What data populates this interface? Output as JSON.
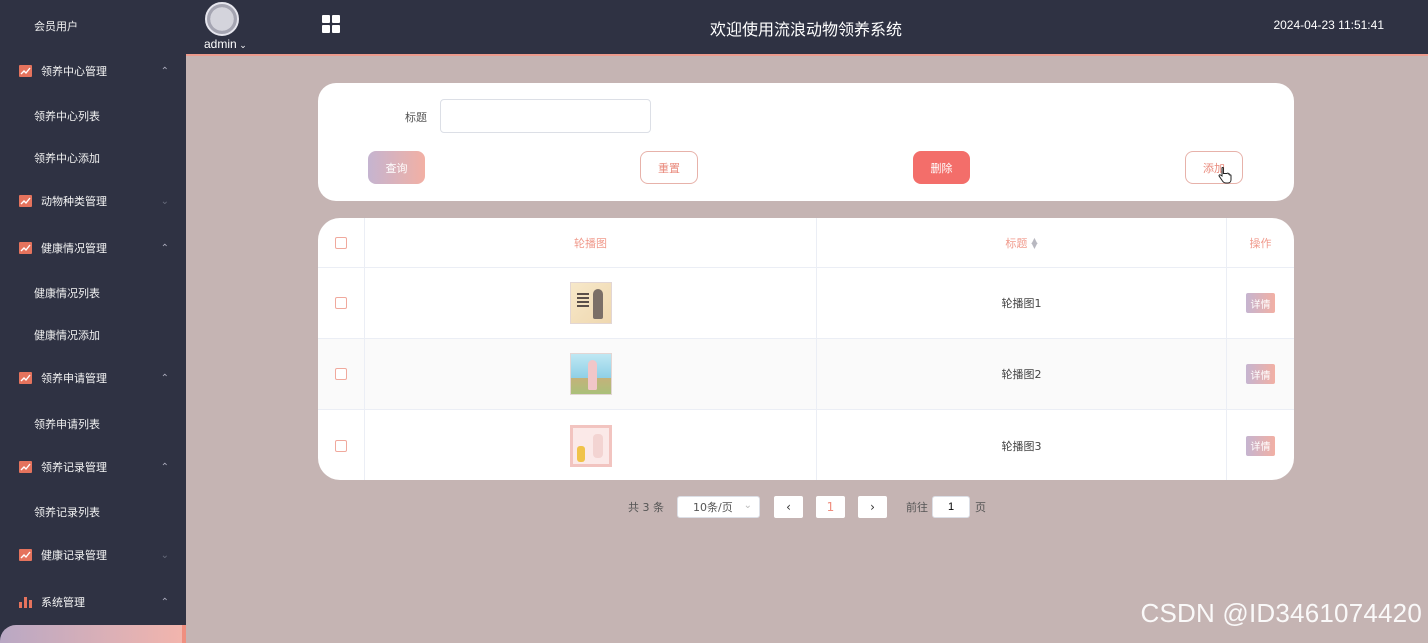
{
  "sidebar": {
    "member_user": "会员用户",
    "adoption_center": {
      "label": "领养中心管理",
      "items": [
        "领养中心列表",
        "领养中心添加"
      ]
    },
    "animal_category": {
      "label": "动物种类管理"
    },
    "health_status": {
      "label": "健康情况管理",
      "items": [
        "健康情况列表",
        "健康情况添加"
      ]
    },
    "adoption_application": {
      "label": "领养申请管理",
      "items": [
        "领养申请列表"
      ]
    },
    "adoption_record": {
      "label": "领养记录管理",
      "items": [
        "领养记录列表"
      ]
    },
    "health_record": {
      "label": "健康记录管理"
    },
    "system": {
      "label": "系统管理"
    }
  },
  "header": {
    "user_name": "admin",
    "title": "欢迎使用流浪动物领养系统",
    "datetime": "2024-04-23 11:51:41"
  },
  "search": {
    "title_label": "标题",
    "title_value": "",
    "query_label": "查询",
    "reset_label": "重置",
    "delete_label": "删除",
    "add_label": "添加"
  },
  "table": {
    "headers": {
      "image": "轮播图",
      "title": "标题",
      "actions": "操作"
    },
    "rows": [
      {
        "title": "轮播图1",
        "action": "详情"
      },
      {
        "title": "轮播图2",
        "action": "详情"
      },
      {
        "title": "轮播图3",
        "action": "详情"
      }
    ]
  },
  "pagination": {
    "total": "共 3 条",
    "page_size": "10条/页",
    "current_page": "1",
    "goto_label": "前往",
    "goto_value": "1",
    "page_unit": "页"
  },
  "watermark": "CSDN @ID3461074420",
  "colors": {
    "sidebar_bg": "#2f3243",
    "accent": "#f09a8c",
    "delete": "#f36e6a",
    "content_bg": "#c5b4b3"
  }
}
